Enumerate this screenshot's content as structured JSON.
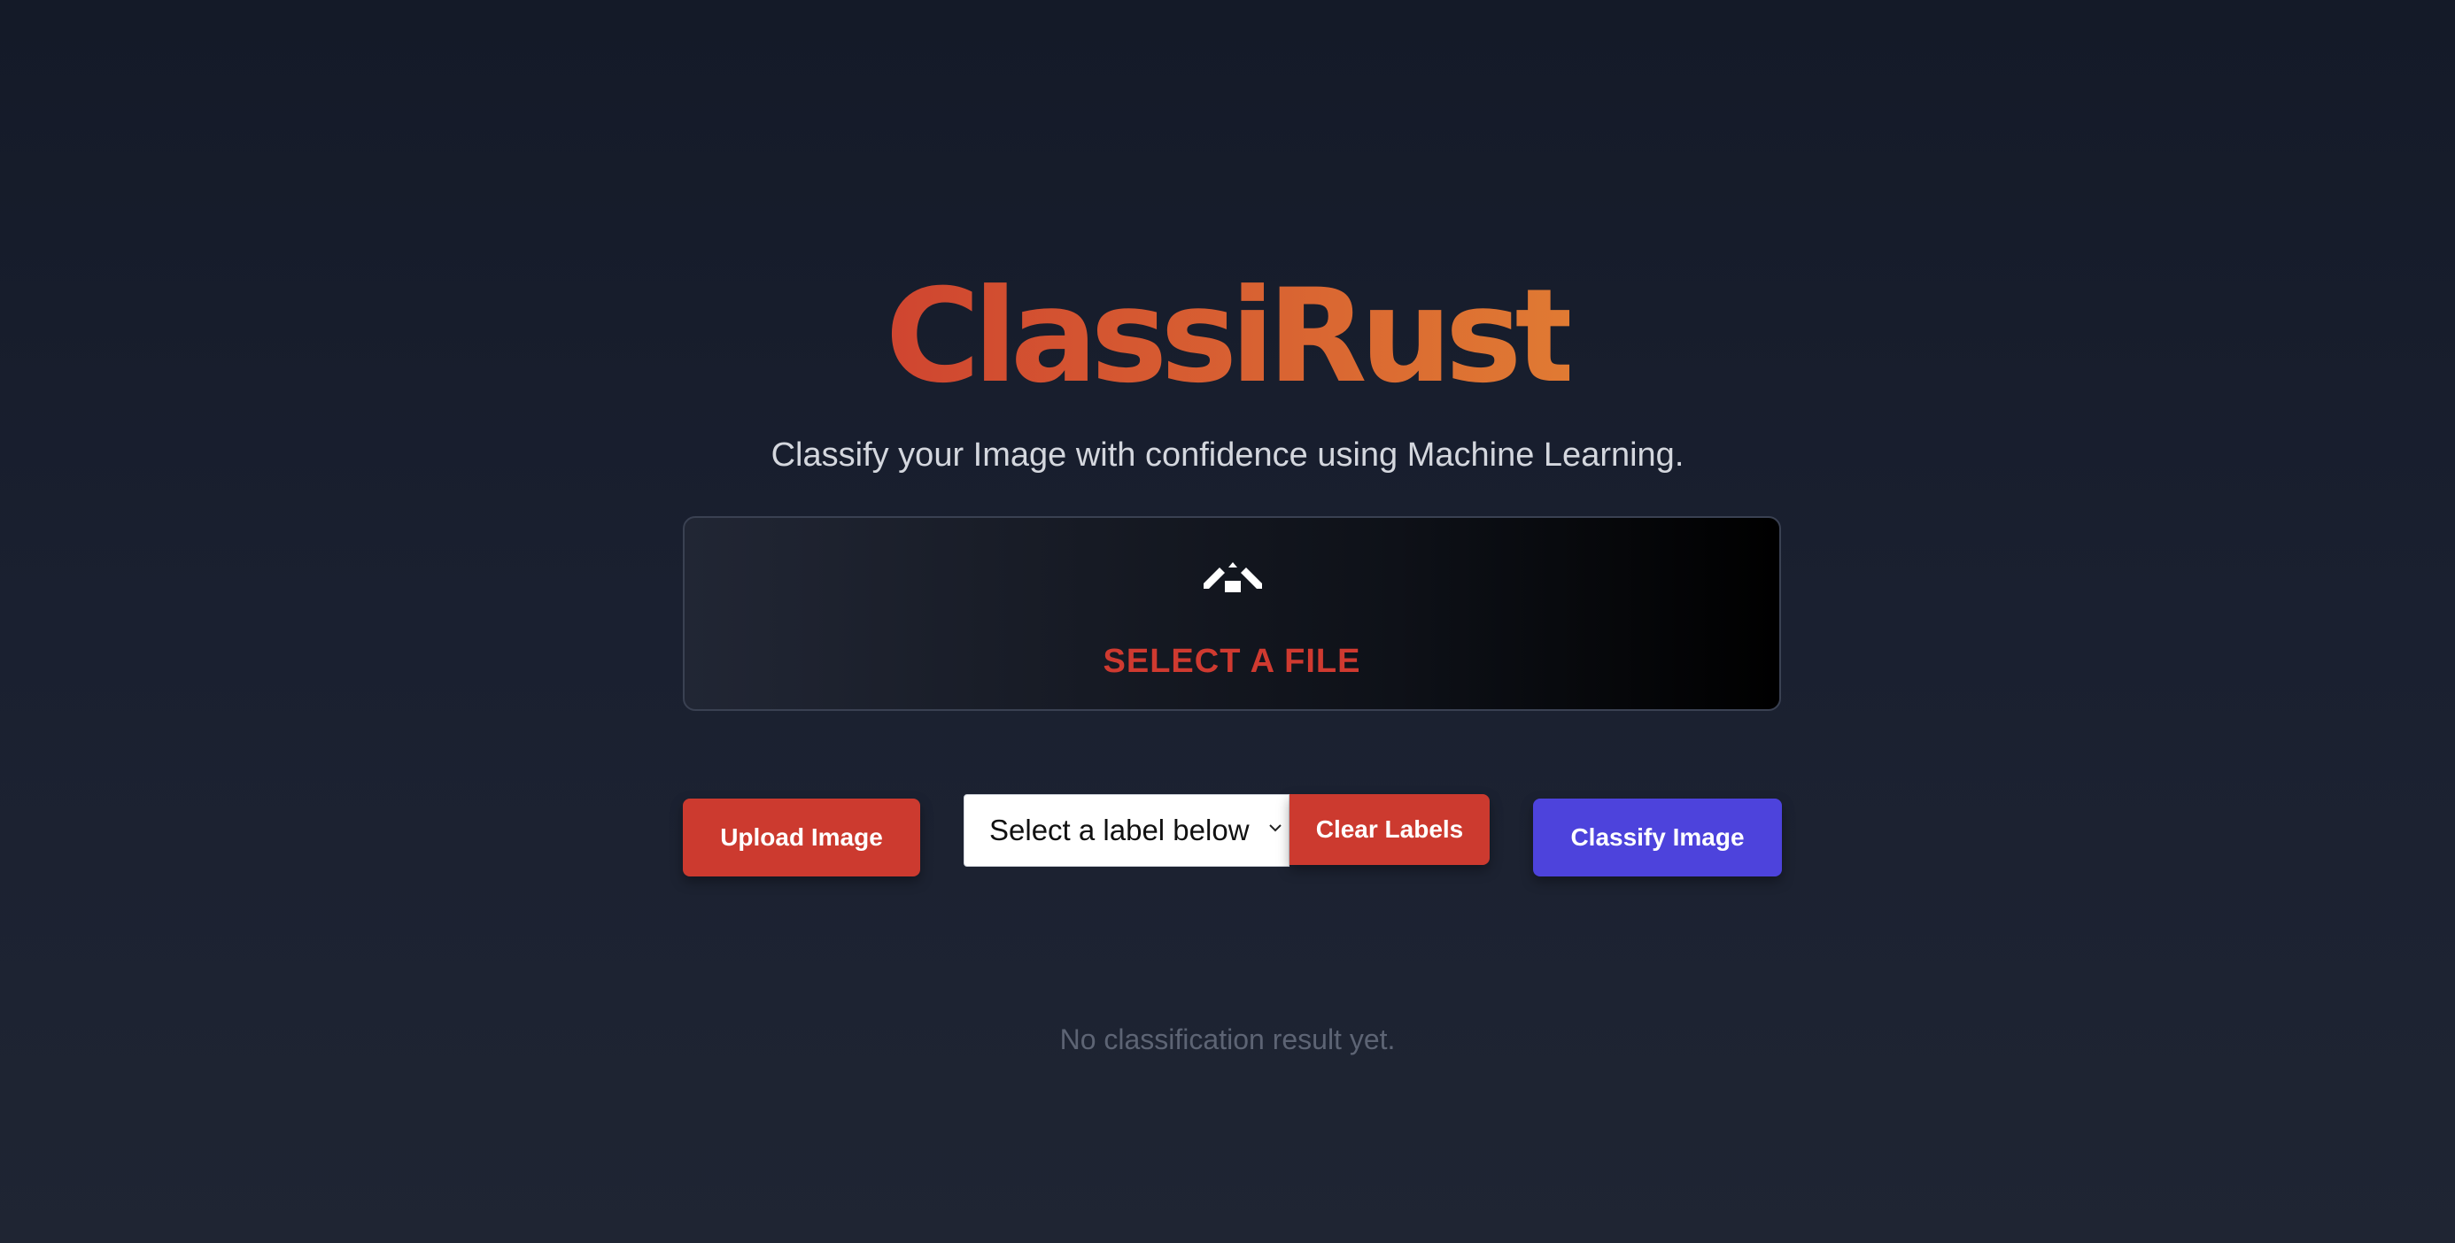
{
  "app": {
    "title": "ClassiRust",
    "subtitle": "Classify your Image with confidence using Machine Learning."
  },
  "dropzone": {
    "icon": "upload-icon",
    "label": "SELECT A FILE"
  },
  "controls": {
    "upload_button": "Upload Image",
    "label_select": {
      "selected": "Select a label below",
      "icon": "chevron-down-icon"
    },
    "clear_button": "Clear Labels",
    "classify_button": "Classify Image"
  },
  "result": {
    "text": "No classification result yet."
  },
  "colors": {
    "title_gradient_start": "#cf4530",
    "title_gradient_end": "#e07a33",
    "danger": "#cc3a2f",
    "primary": "#4d43dc",
    "background": "#1a2030"
  }
}
